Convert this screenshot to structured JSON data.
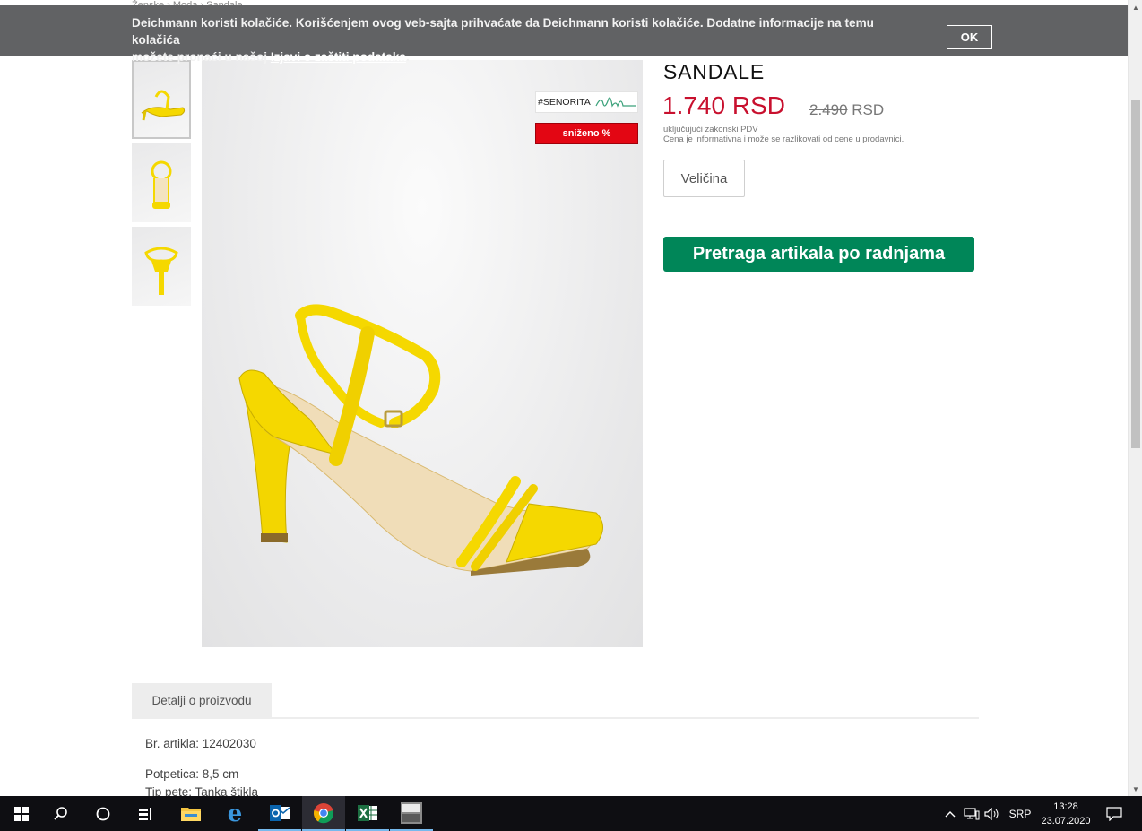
{
  "cookie_banner": {
    "text_line1": "Deichmann koristi kolačiće. Korišćenjem ovog veb-sajta prihvaćate da Deichmann koristi kolačiće. Dodatne informacije na temu kolačića",
    "text_line2": "možete pronaći u našoj ",
    "link_text": "Izjavi o zaštiti podataka",
    "text_end": ".",
    "ok_label": "OK"
  },
  "breadcrumb": "Ženske › Moda › Sandale",
  "product": {
    "title": "SANDALE",
    "price_now": "1.740 RSD",
    "price_old": "2.490",
    "price_old_currency": " RSD",
    "vat_line1": "uključujući zakonski PDV",
    "vat_line2": "Cena je informativna i može se razlikovati od cene u prodavnici.",
    "size_label": "Veličina",
    "store_search_label": "Pretraga artikala po radnjama"
  },
  "image_badges": {
    "senorita": "#SENORITA",
    "sale": "sniženo %"
  },
  "tabs": {
    "details_label": "Detalji o proizvodu"
  },
  "details": {
    "article": "Br. artikla: 12402030",
    "sole": "Potpetica: 8,5 cm",
    "heel_type": "Tip pete: Tanka štikla"
  },
  "taskbar": {
    "language": "SRP",
    "time": "13:28",
    "date": "23.07.2020",
    "icons": [
      "windows-icon",
      "search-icon",
      "cortana-icon",
      "task-view-icon",
      "file-explorer-icon",
      "edge-icon",
      "outlook-icon",
      "chrome-icon",
      "excel-icon",
      "app-icon"
    ]
  },
  "colors": {
    "price_red": "#c8102e",
    "store_button_green": "#008658",
    "sale_badge_red": "#e30613",
    "cookie_bar": "#616264",
    "sandal_yellow": "#f5d800"
  }
}
